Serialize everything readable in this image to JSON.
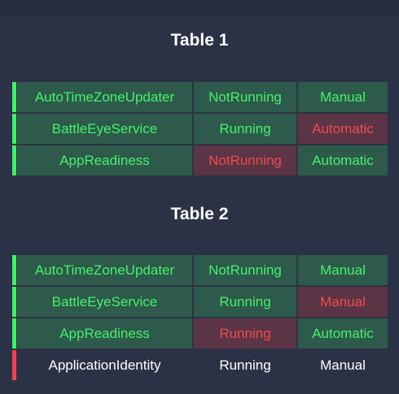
{
  "colors": {
    "background": "#2c3246",
    "ok_cell_bg": "#2d5a4b",
    "ok_text": "#45f26a",
    "bad_cell_bg": "#5b3446",
    "bad_text": "#f04c4c",
    "ok_bar": "#3ef06b",
    "bad_bar": "#ef4454",
    "plain_text": "#ffffff"
  },
  "tables": [
    {
      "title": "Table 1",
      "rows": [
        {
          "bar": "ok",
          "cells": [
            {
              "text": "AutoTimeZoneUpdater",
              "status": "good"
            },
            {
              "text": "NotRunning",
              "status": "good"
            },
            {
              "text": "Manual",
              "status": "good"
            }
          ]
        },
        {
          "bar": "ok",
          "cells": [
            {
              "text": "BattleEyeService",
              "status": "good"
            },
            {
              "text": "Running",
              "status": "good"
            },
            {
              "text": "Automatic",
              "status": "bad"
            }
          ]
        },
        {
          "bar": "ok",
          "cells": [
            {
              "text": "AppReadiness",
              "status": "good"
            },
            {
              "text": "NotRunning",
              "status": "bad"
            },
            {
              "text": "Automatic",
              "status": "good"
            }
          ]
        }
      ]
    },
    {
      "title": "Table 2",
      "rows": [
        {
          "bar": "ok",
          "cells": [
            {
              "text": "AutoTimeZoneUpdater",
              "status": "good"
            },
            {
              "text": "NotRunning",
              "status": "good"
            },
            {
              "text": "Manual",
              "status": "good"
            }
          ]
        },
        {
          "bar": "ok",
          "cells": [
            {
              "text": "BattleEyeService",
              "status": "good"
            },
            {
              "text": "Running",
              "status": "good"
            },
            {
              "text": "Manual",
              "status": "bad"
            }
          ]
        },
        {
          "bar": "ok",
          "cells": [
            {
              "text": "AppReadiness",
              "status": "good"
            },
            {
              "text": "Running",
              "status": "bad"
            },
            {
              "text": "Automatic",
              "status": "good"
            }
          ]
        },
        {
          "bar": "bad",
          "cells": [
            {
              "text": "ApplicationIdentity",
              "status": "plain"
            },
            {
              "text": "Running",
              "status": "plain"
            },
            {
              "text": "Manual",
              "status": "plain"
            }
          ]
        }
      ]
    }
  ]
}
